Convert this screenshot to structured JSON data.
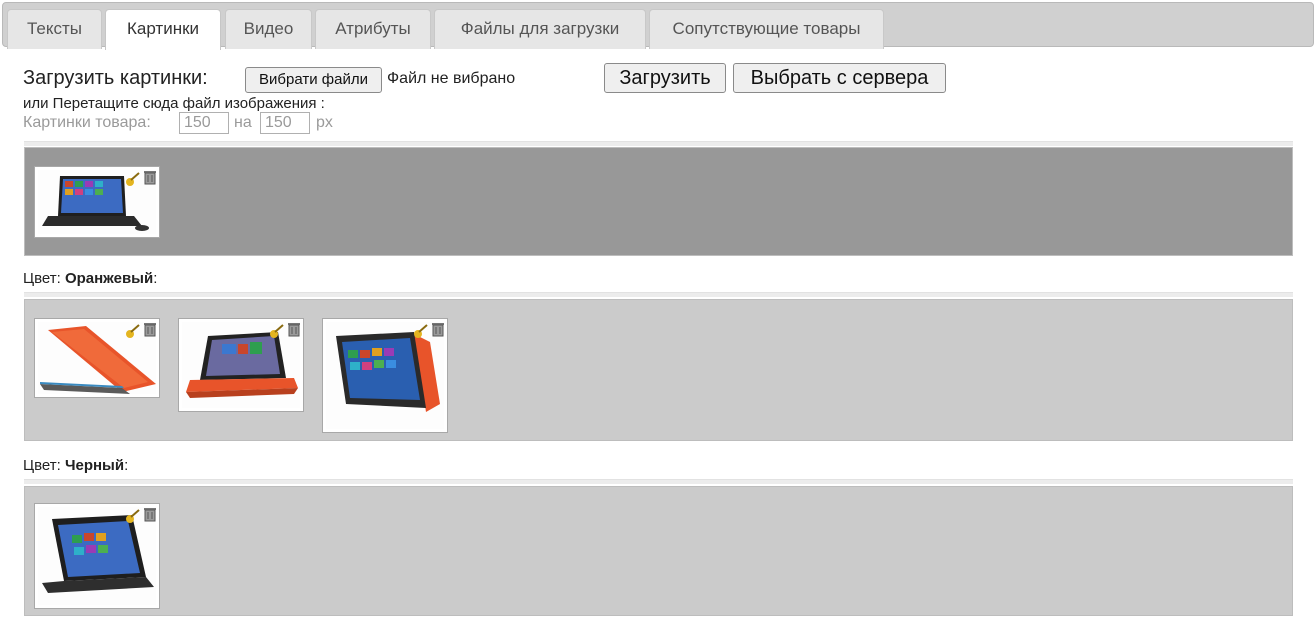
{
  "tabs": [
    {
      "label": "Тексты",
      "active": false
    },
    {
      "label": "Картинки",
      "active": true
    },
    {
      "label": "Видео",
      "active": false
    },
    {
      "label": "Атрибуты",
      "active": false
    },
    {
      "label": "Файлы для загрузки",
      "active": false
    },
    {
      "label": "Сопутствующие товары",
      "active": false
    }
  ],
  "upload": {
    "label": "Загрузить картинки:",
    "choose_button": "Вибрати файли",
    "file_status": "Файл не вибрано",
    "upload_button": "Загрузить",
    "server_button": "Выбрать с сервера",
    "drag_hint": "или Перетащите сюда файл изображения :"
  },
  "image_size": {
    "label": "Картинки товара:",
    "width": "150",
    "separator": "на",
    "height": "150",
    "unit": "px"
  },
  "groups": [
    {
      "color_prefix": "",
      "color_name": "",
      "images": [
        "laptop-black-front"
      ]
    },
    {
      "color_prefix": "Цвет:",
      "color_name": "Оранжевый",
      "suffix": ":",
      "images": [
        "laptop-orange-side",
        "laptop-orange-angle",
        "laptop-orange-tent"
      ]
    },
    {
      "color_prefix": "Цвет:",
      "color_name": "Черный",
      "suffix": ":",
      "images": [
        "laptop-black-stand"
      ]
    }
  ],
  "colors": {
    "tabbar_bg": "#d0d0d0",
    "gallery_dark": "#989898",
    "gallery_light": "#cbcbcb",
    "laptop_orange": "#e8542a",
    "screen_blue": "#2a5fb0"
  }
}
